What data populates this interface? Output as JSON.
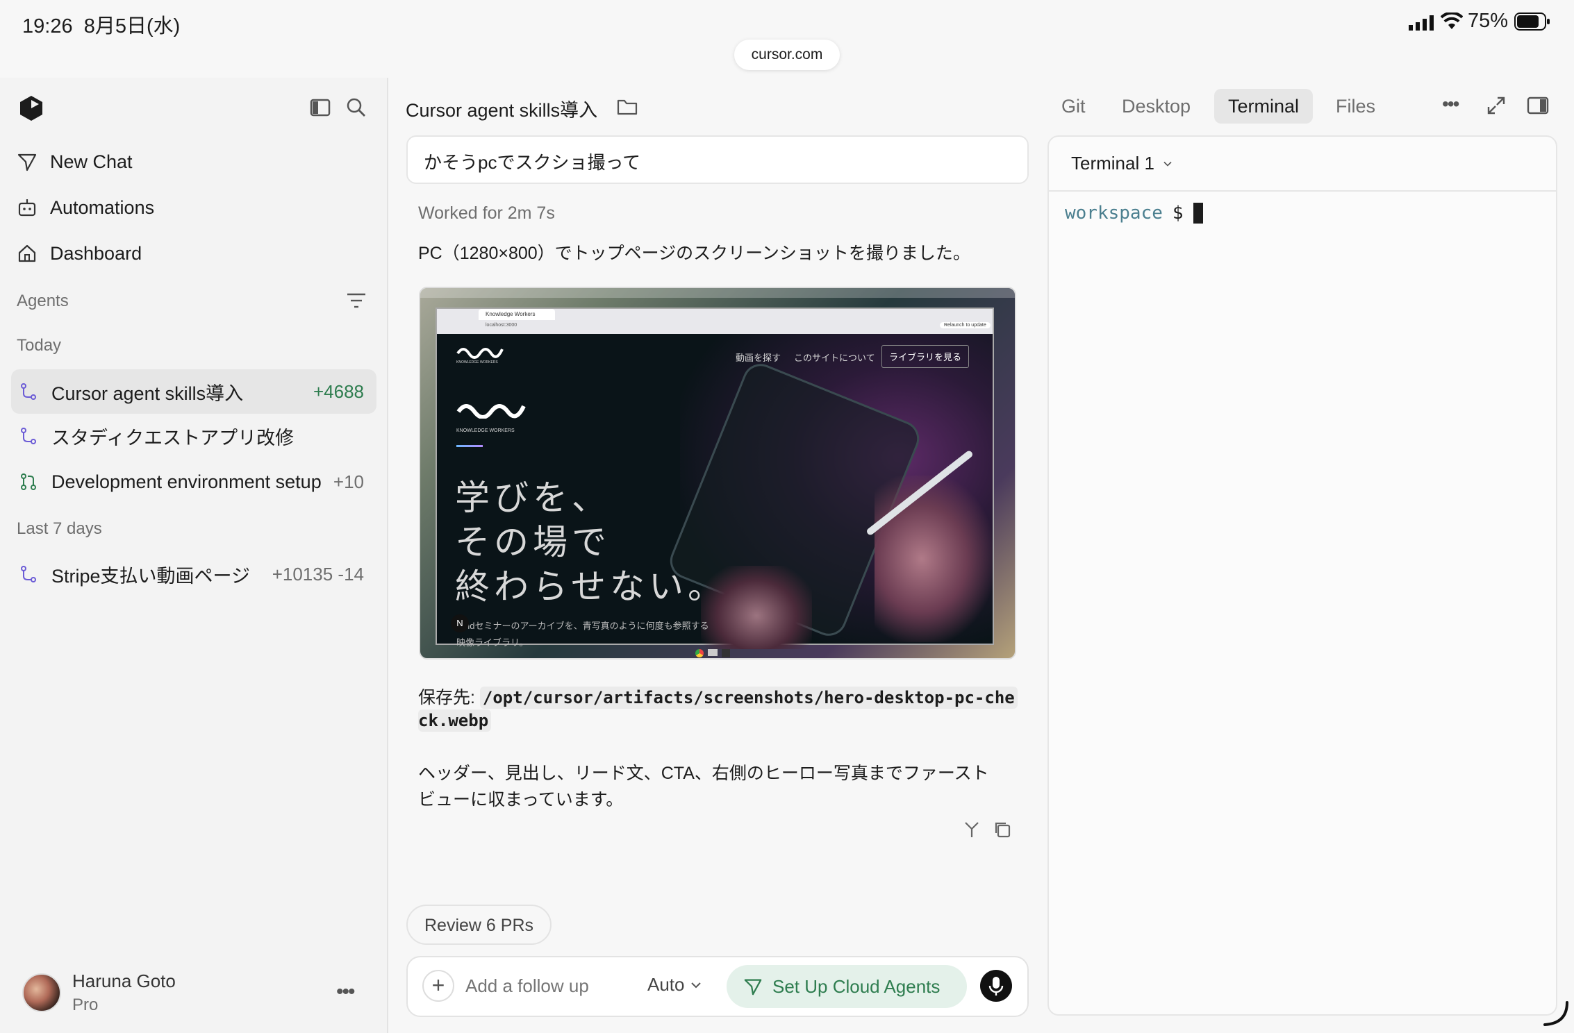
{
  "status_bar": {
    "time": "19:26",
    "date": "8月5日(水)",
    "url": "cursor.com",
    "battery": "75%"
  },
  "sidebar": {
    "nav": [
      {
        "label": "New Chat",
        "icon": "send-icon"
      },
      {
        "label": "Automations",
        "icon": "robot-icon"
      },
      {
        "label": "Dashboard",
        "icon": "home-icon"
      }
    ],
    "agents_label": "Agents",
    "today_label": "Today",
    "last7_label": "Last 7 days",
    "agents_today": [
      {
        "label": "Cursor agent skills導入",
        "stat": "+4688",
        "active": true
      },
      {
        "label": "スタディクエストアプリ改修",
        "stat": ""
      },
      {
        "label": "Development environment setup",
        "stat": "+10"
      }
    ],
    "agents_last7": [
      {
        "label": "Stripe支払い動画ページ",
        "stat": "+10135 -14"
      }
    ],
    "user": {
      "name": "Haruna Goto",
      "plan": "Pro"
    }
  },
  "main": {
    "title": "Cursor agent skills導入",
    "tabs": [
      "Git",
      "Desktop",
      "Terminal",
      "Files"
    ],
    "active_tab": "Terminal",
    "user_message": "かそうpcでスクショ撮って",
    "worked_for": "Worked for 2m 7s",
    "reply_1": "PC（1280×800）でトップページのスクリーンショットを撮りました。",
    "save_label": "保存先:",
    "save_path_1": "/opt/cursor/artifacts/screenshots/hero-desktop-pc-che",
    "save_path_2": "ck.webp",
    "reply_2a": "ヘッダー、見出し、リード文、CTA、右側のヒーロー写真までファースト",
    "reply_2b": "ビューに収まっています。",
    "review_button": "Review 6 PRs",
    "composer": {
      "placeholder": "Add a follow up",
      "model": "Auto",
      "cloud_button": "Set Up Cloud Agents"
    }
  },
  "screenshot_content": {
    "brand": "KNOWLEDGE WORKERS",
    "browser_tab": "Knowledge Workers",
    "address": "localhost:3000",
    "relaunch": "Relaunch to update",
    "nav_1": "動画を探す",
    "nav_2": "このサイトについて",
    "nav_cta": "ライブラリを見る",
    "headline_1": "学びを、",
    "headline_2": "その場で",
    "headline_3": "終わらせない。",
    "lead_1": "ndセミナーのアーカイブを、青写真のように何度も参照する",
    "lead_2": "映像ライブラリ。"
  },
  "terminal": {
    "tab_label": "Terminal 1",
    "prompt": "workspace",
    "symbol": "$"
  }
}
